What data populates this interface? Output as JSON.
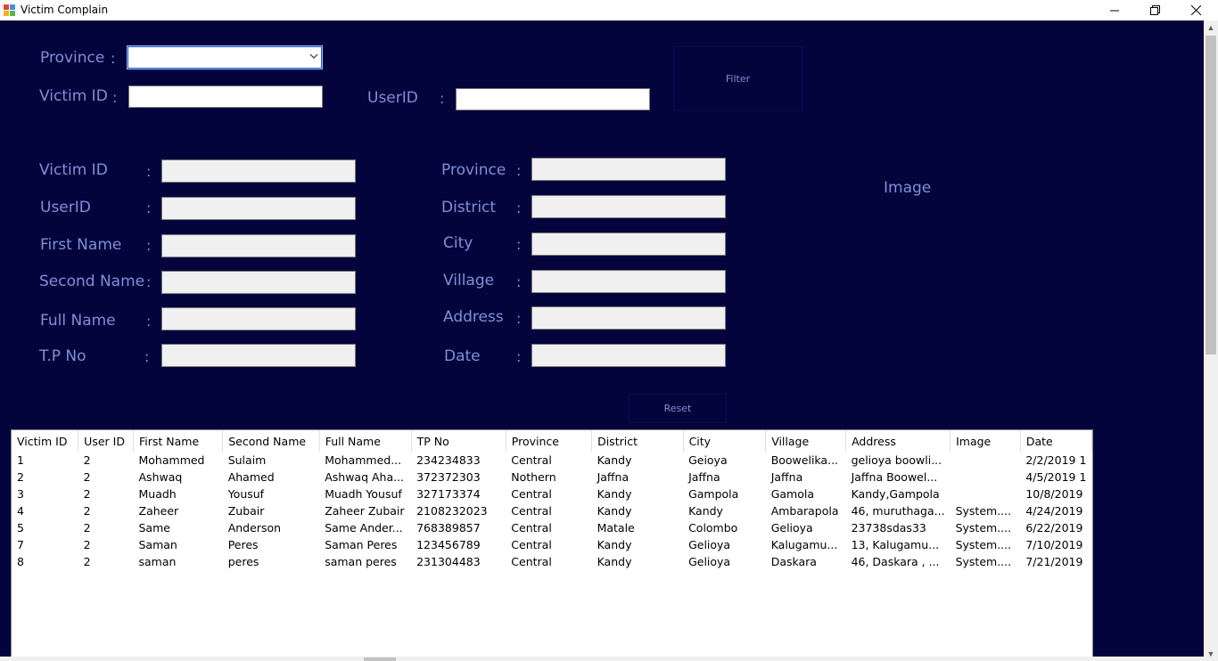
{
  "window": {
    "title": "Victim Complain"
  },
  "filter": {
    "province_label": "Province",
    "victim_id_label": "Victim ID",
    "user_id_label": "UserID",
    "province_value": "",
    "victim_id_value": "",
    "user_id_value": "",
    "filter_button": "Filter"
  },
  "details": {
    "left": [
      {
        "label": "Victim ID",
        "value": ""
      },
      {
        "label": "UserID",
        "value": ""
      },
      {
        "label": "First Name",
        "value": ""
      },
      {
        "label": "Second Name",
        "value": ""
      },
      {
        "label": "Full Name",
        "value": ""
      },
      {
        "label": "T.P No",
        "value": ""
      }
    ],
    "right": [
      {
        "label": "Province",
        "value": ""
      },
      {
        "label": "District",
        "value": ""
      },
      {
        "label": "City",
        "value": ""
      },
      {
        "label": "Village",
        "value": ""
      },
      {
        "label": "Address",
        "value": ""
      },
      {
        "label": "Date",
        "value": ""
      }
    ],
    "colon": ":",
    "image_label": "Image",
    "reset_button": "Reset"
  },
  "grid": {
    "columns": [
      "Victim ID",
      "User ID",
      "First Name",
      "Second Name",
      "Full Name",
      "TP No",
      "Province",
      "District",
      "City",
      "Village",
      "Address",
      "Image",
      "Date"
    ],
    "rows": [
      [
        "1",
        "2",
        "Mohammed",
        "Sulaim",
        "Mohammed...",
        "234234833",
        "Central",
        "Kandy",
        "Geioya",
        "Boowelika...",
        "gelioya boowli...",
        "",
        "2/2/2019 1"
      ],
      [
        "2",
        "2",
        "Ashwaq",
        "Ahamed",
        "Ashwaq Aha...",
        "372372303",
        "Nothern",
        "Jaffna",
        "Jaffna",
        "Jaffna",
        "Jaffna Boowel...",
        "",
        "4/5/2019 1"
      ],
      [
        "3",
        "2",
        "Muadh",
        "Yousuf",
        "Muadh Yousuf",
        "327173374",
        "Central",
        "Kandy",
        "Gampola",
        "Gamola",
        "Kandy,Gampola",
        "",
        "10/8/2019"
      ],
      [
        "4",
        "2",
        "Zaheer",
        "Zubair",
        "Zaheer Zubair",
        "2108232023",
        "Central",
        "Kandy",
        "Kandy",
        "Ambarapola",
        "46, muruthaga...",
        "System....",
        "4/24/2019"
      ],
      [
        "5",
        "2",
        "Same",
        "Anderson",
        "Same Ander...",
        "768389857",
        "Central",
        "Matale",
        "Colombo",
        "Gelioya",
        "23738sdas33",
        "System....",
        "6/22/2019"
      ],
      [
        "7",
        "2",
        "Saman",
        "Peres",
        "Saman Peres",
        "123456789",
        "Central",
        "Kandy",
        "Gelioya",
        "Kalugamu...",
        "13, Kalugamu...",
        "System....",
        "7/10/2019"
      ],
      [
        "8",
        "2",
        "saman",
        "peres",
        "saman peres",
        "231304483",
        "Central",
        "Kandy",
        "Gelioya",
        "Daskara",
        "46, Daskara , ...",
        "System....",
        "7/21/2019"
      ]
    ]
  }
}
